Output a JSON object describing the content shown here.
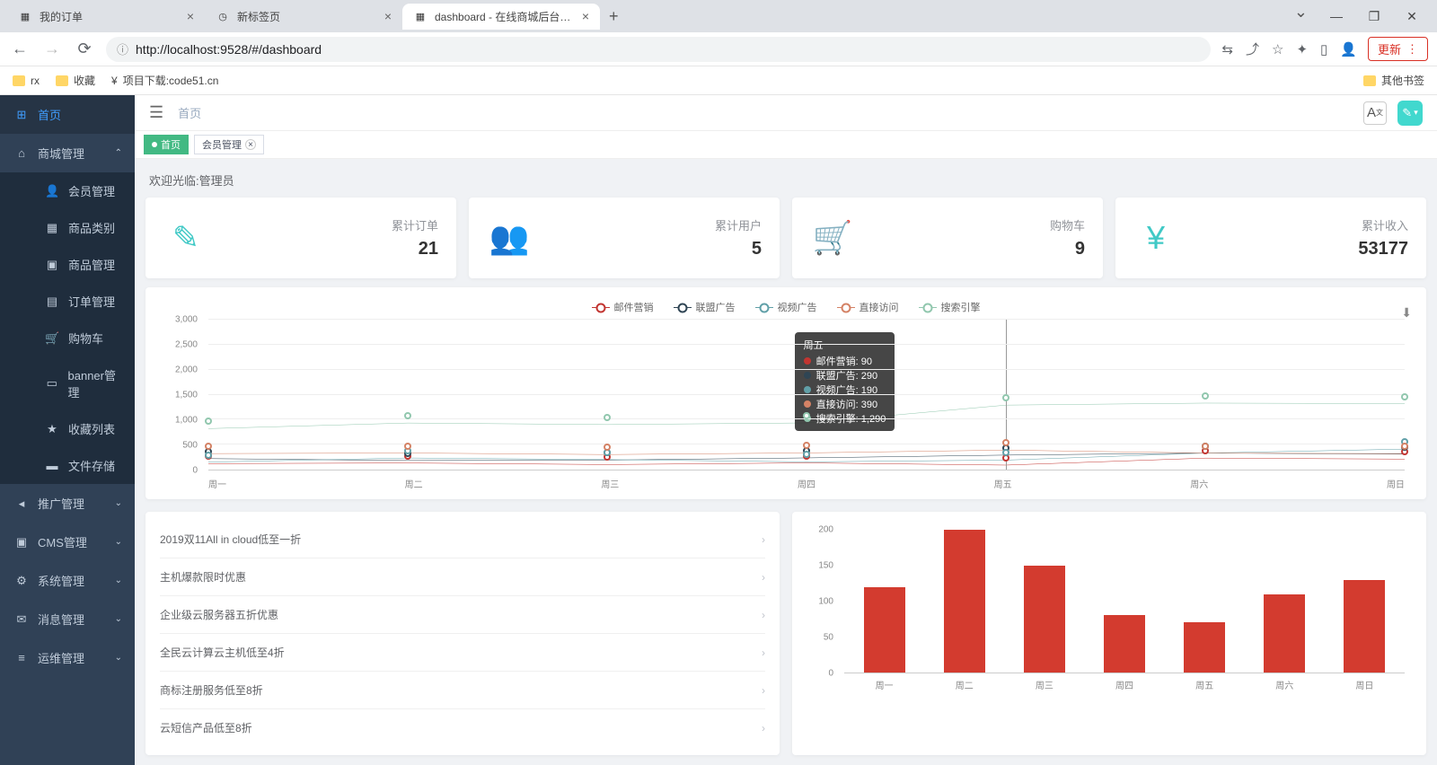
{
  "browser": {
    "tabs": [
      {
        "title": "我的订单",
        "active": false
      },
      {
        "title": "新标签页",
        "active": false
      },
      {
        "title": "dashboard - 在线商城后台管理",
        "active": true
      }
    ],
    "url": "http://localhost:9528/#/dashboard",
    "update_label": "更新",
    "bookmarks": [
      {
        "label": "rx"
      },
      {
        "label": "收藏"
      },
      {
        "label": "项目下载:code51.cn"
      }
    ],
    "other_bookmarks": "其他书签"
  },
  "sidebar": {
    "items": [
      {
        "label": "首页",
        "icon": "dashboard"
      },
      {
        "label": "商城管理",
        "icon": "shop",
        "expanded": true,
        "children": [
          {
            "label": "会员管理"
          },
          {
            "label": "商品类别"
          },
          {
            "label": "商品管理"
          },
          {
            "label": "订单管理"
          },
          {
            "label": "购物车"
          },
          {
            "label": "banner管理"
          },
          {
            "label": "收藏列表"
          },
          {
            "label": "文件存储"
          }
        ]
      },
      {
        "label": "推广管理",
        "icon": "promo"
      },
      {
        "label": "CMS管理",
        "icon": "cms"
      },
      {
        "label": "系统管理",
        "icon": "gear"
      },
      {
        "label": "消息管理",
        "icon": "msg"
      },
      {
        "label": "运维管理",
        "icon": "ops"
      }
    ]
  },
  "breadcrumb": "首页",
  "tags": [
    {
      "label": "首页",
      "active": true
    },
    {
      "label": "会员管理",
      "active": false,
      "closable": true
    }
  ],
  "welcome": "欢迎光临:管理员",
  "stats": [
    {
      "label": "累计订单",
      "value": "21",
      "icon": "edit"
    },
    {
      "label": "累计用户",
      "value": "5",
      "icon": "users"
    },
    {
      "label": "购物车",
      "value": "9",
      "icon": "cart"
    },
    {
      "label": "累计收入",
      "value": "53177",
      "icon": "yen"
    }
  ],
  "chart_data": {
    "type": "line",
    "categories": [
      "周一",
      "周二",
      "周三",
      "周四",
      "周五",
      "周六",
      "周日"
    ],
    "series": [
      {
        "name": "邮件营销",
        "color": "#c23531",
        "values": [
          120,
          132,
          101,
          134,
          90,
          230,
          210
        ]
      },
      {
        "name": "联盟广告",
        "color": "#2f4554",
        "values": [
          220,
          182,
          191,
          234,
          290,
          330,
          310
        ]
      },
      {
        "name": "视频广告",
        "color": "#61a0a8",
        "values": [
          150,
          232,
          201,
          154,
          190,
          330,
          410
        ]
      },
      {
        "name": "直接访问",
        "color": "#d48265",
        "values": [
          320,
          332,
          301,
          334,
          390,
          330,
          320
        ]
      },
      {
        "name": "搜索引擎",
        "color": "#91c7ae",
        "values": [
          820,
          932,
          901,
          934,
          1290,
          1330,
          1320
        ]
      }
    ],
    "ylim": [
      0,
      3000
    ],
    "y_ticks": [
      0,
      500,
      1000,
      1500,
      2000,
      2500,
      3000
    ],
    "tooltip": {
      "category": "周五",
      "rows": [
        {
          "name": "邮件营销",
          "value": 90,
          "color": "#c23531"
        },
        {
          "name": "联盟广告",
          "value": 290,
          "color": "#2f4554"
        },
        {
          "name": "视频广告",
          "value": 190,
          "color": "#61a0a8"
        },
        {
          "name": "直接访问",
          "value": 390,
          "color": "#d48265"
        },
        {
          "name": "搜索引擎",
          "value": 1290,
          "color": "#91c7ae"
        }
      ]
    }
  },
  "news_list": [
    "2019双11All in cloud低至一折",
    "主机爆款限时优惠",
    "企业级云服务器五折优惠",
    "全民云计算云主机低至4折",
    "商标注册服务低至8折",
    "云短信产品低至8折"
  ],
  "bar_chart": {
    "type": "bar",
    "categories": [
      "周一",
      "周二",
      "周三",
      "周四",
      "周五",
      "周六",
      "周日"
    ],
    "values": [
      120,
      200,
      150,
      80,
      70,
      110,
      130
    ],
    "ylim": [
      0,
      200
    ],
    "y_ticks": [
      0,
      50,
      100,
      150,
      200
    ]
  }
}
